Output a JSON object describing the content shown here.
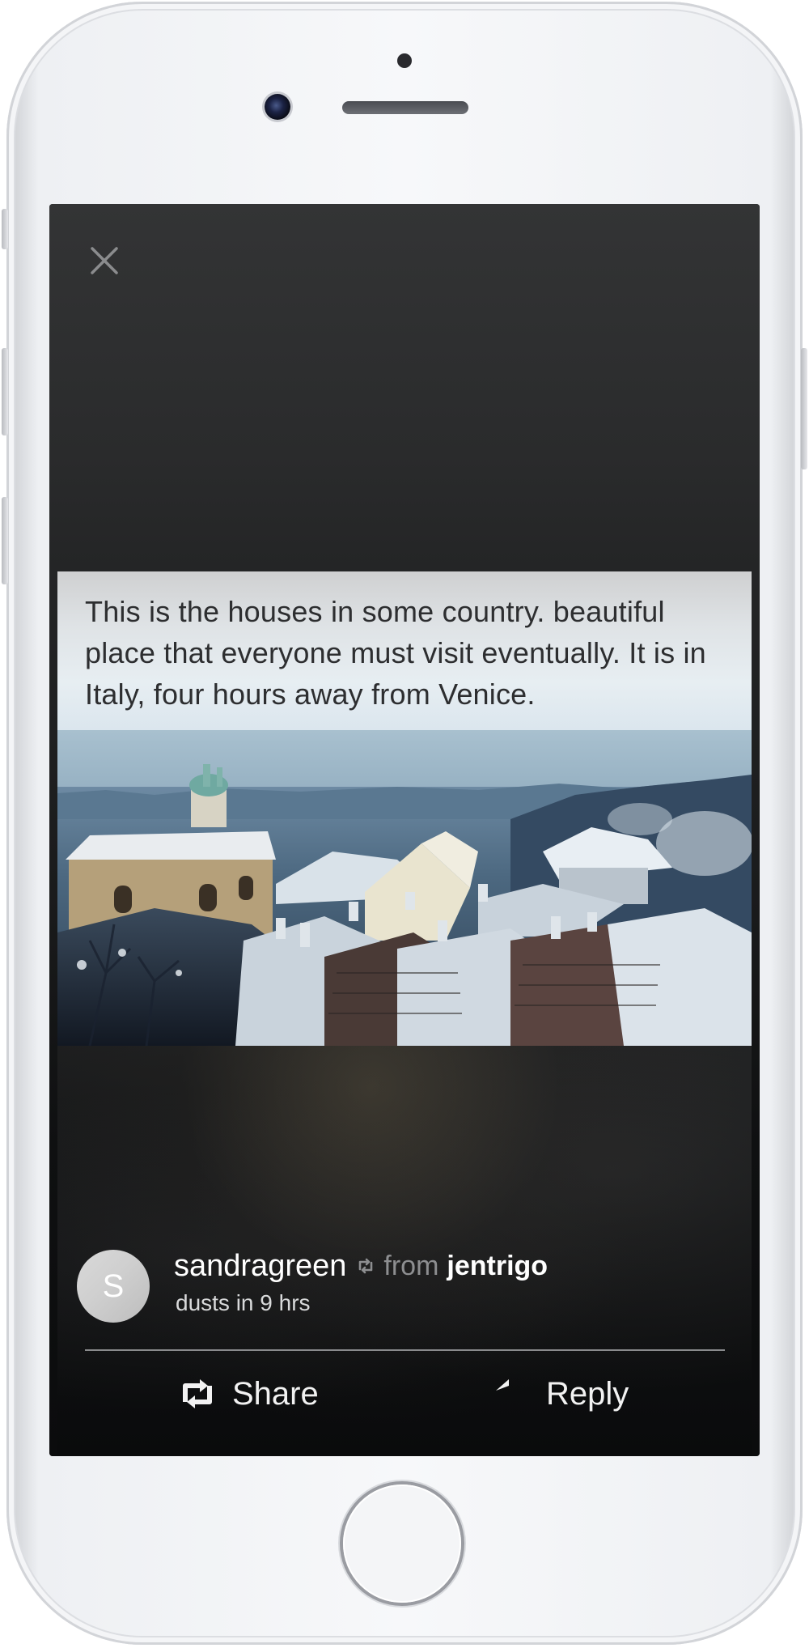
{
  "post": {
    "caption": "This is the houses in some country. beautiful place that everyone must visit eventually. It is in Italy, four hours away from Venice."
  },
  "author": {
    "avatar_letter": "S",
    "username": "sandragreen",
    "from_label": "from",
    "source_username": "jentrigo",
    "expiry": "dusts in 9 hrs"
  },
  "actions": {
    "share_label": "Share",
    "reply_label": "Reply"
  },
  "icons": {
    "close": "close-icon",
    "repost_small": "repost-icon",
    "share": "share-icon",
    "reply": "reply-icon"
  },
  "colors": {
    "screen_background": "#2a2b2c",
    "caption_background": "#e2e8ec",
    "caption_text": "#2d2e30",
    "username_text": "#ffffff",
    "muted_text": "#8d8e90"
  }
}
